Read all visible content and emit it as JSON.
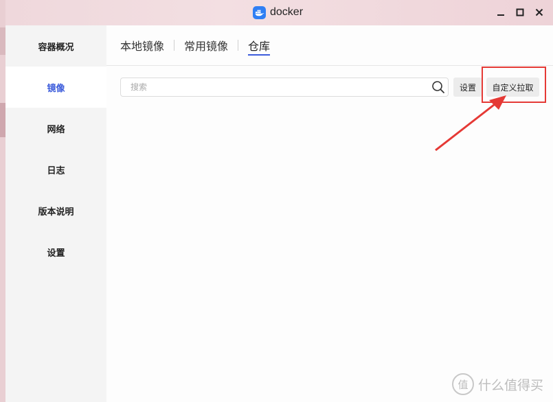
{
  "window": {
    "title": "docker"
  },
  "sidebar": {
    "items": [
      {
        "label": "容器概况"
      },
      {
        "label": "镜像"
      },
      {
        "label": "网络"
      },
      {
        "label": "日志"
      },
      {
        "label": "版本说明"
      },
      {
        "label": "设置"
      }
    ]
  },
  "tabs": [
    {
      "label": "本地镜像"
    },
    {
      "label": "常用镜像"
    },
    {
      "label": "仓库"
    }
  ],
  "toolbar": {
    "search_placeholder": "搜索",
    "settings_label": "设置",
    "pull_label": "自定义拉取"
  },
  "watermark": {
    "logo_char": "值",
    "text": "什么值得买"
  },
  "colors": {
    "accent": "#3b5bdb",
    "annotation": "#e53935",
    "docker_blue": "#2f7ff4"
  }
}
